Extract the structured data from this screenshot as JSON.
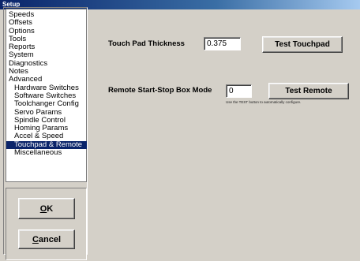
{
  "window": {
    "title": "Setup"
  },
  "nav": {
    "items": [
      {
        "label": "Speeds",
        "level": 0
      },
      {
        "label": "Offsets",
        "level": 0
      },
      {
        "label": "Options",
        "level": 0
      },
      {
        "label": "Tools",
        "level": 0
      },
      {
        "label": "Reports",
        "level": 0
      },
      {
        "label": "System",
        "level": 0
      },
      {
        "label": "Diagnostics",
        "level": 0
      },
      {
        "label": "Notes",
        "level": 0
      },
      {
        "label": "Advanced",
        "level": 0
      },
      {
        "label": "Hardware Switches",
        "level": 1
      },
      {
        "label": "Software Switches",
        "level": 1
      },
      {
        "label": "Toolchanger Config",
        "level": 1
      },
      {
        "label": "Servo Params",
        "level": 1
      },
      {
        "label": "Spindle Control",
        "level": 1
      },
      {
        "label": "Homing Params",
        "level": 1
      },
      {
        "label": "Accel & Speed",
        "level": 1
      },
      {
        "label": "Touchpad & Remote",
        "level": 1,
        "selected": true
      },
      {
        "label": "Miscellaneous",
        "level": 1
      }
    ]
  },
  "buttons": {
    "ok_label_accel": "O",
    "ok_label_rest": "K",
    "cancel_label_accel": "C",
    "cancel_label_rest": "ancel"
  },
  "touchpad": {
    "label": "Touch Pad Thickness",
    "value": "0.375",
    "button_label": "Test Touchpad"
  },
  "remote": {
    "label": "Remote Start-Stop Box Mode",
    "value": "0",
    "button_label": "Test Remote",
    "hint": "Use the TEST button to automatically configure."
  },
  "colors": {
    "selection": "#0a246a",
    "face": "#d4d0c8"
  }
}
